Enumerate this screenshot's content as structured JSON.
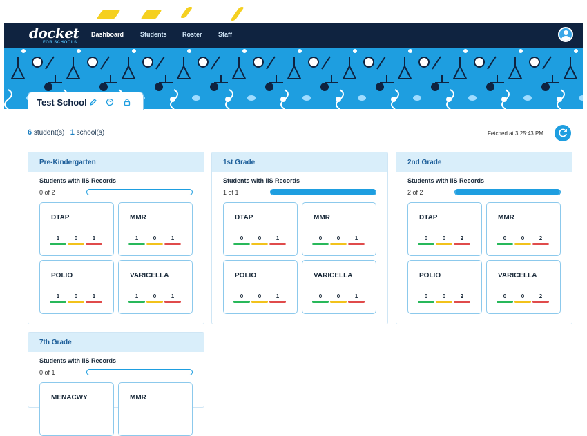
{
  "nav": {
    "logo_text": "docket",
    "logo_sub": "FOR SCHOOLS",
    "items": [
      {
        "label": "Dashboard"
      },
      {
        "label": "Students"
      },
      {
        "label": "Roster"
      },
      {
        "label": "Staff"
      }
    ]
  },
  "school": {
    "name": "Test School"
  },
  "summary": {
    "student_count": "6",
    "student_label": "student(s)",
    "school_count": "1",
    "school_label": "school(s)",
    "fetched": "Fetched at 3:25:43 PM"
  },
  "colors": {
    "navy": "#0f2340",
    "accent": "#1e9ee0",
    "green": "#28b85a",
    "yellow": "#f2c21b",
    "red": "#e04b4b"
  },
  "icons": [
    "user-avatar-icon",
    "pencil-icon",
    "palette-icon",
    "lock-icon",
    "refresh-icon"
  ],
  "grades": [
    {
      "title": "Pre-Kindergarten",
      "iis_label": "Students with IIS Records",
      "iis_count": "0 of 2",
      "iis_fraction": 0,
      "vaccines": [
        {
          "name": "DTAP",
          "green": "1",
          "yellow": "0",
          "red": "1"
        },
        {
          "name": "MMR",
          "green": "1",
          "yellow": "0",
          "red": "1"
        },
        {
          "name": "POLIO",
          "green": "1",
          "yellow": "0",
          "red": "1"
        },
        {
          "name": "VARICELLA",
          "green": "1",
          "yellow": "0",
          "red": "1"
        }
      ]
    },
    {
      "title": "1st Grade",
      "iis_label": "Students with IIS Records",
      "iis_count": "1 of 1",
      "iis_fraction": 1,
      "vaccines": [
        {
          "name": "DTAP",
          "green": "0",
          "yellow": "0",
          "red": "1"
        },
        {
          "name": "MMR",
          "green": "0",
          "yellow": "0",
          "red": "1"
        },
        {
          "name": "POLIO",
          "green": "0",
          "yellow": "0",
          "red": "1"
        },
        {
          "name": "VARICELLA",
          "green": "0",
          "yellow": "0",
          "red": "1"
        }
      ]
    },
    {
      "title": "2nd Grade",
      "iis_label": "Students with IIS Records",
      "iis_count": "2 of 2",
      "iis_fraction": 1,
      "vaccines": [
        {
          "name": "DTAP",
          "green": "0",
          "yellow": "0",
          "red": "2"
        },
        {
          "name": "MMR",
          "green": "0",
          "yellow": "0",
          "red": "2"
        },
        {
          "name": "POLIO",
          "green": "0",
          "yellow": "0",
          "red": "2"
        },
        {
          "name": "VARICELLA",
          "green": "0",
          "yellow": "0",
          "red": "2"
        }
      ]
    },
    {
      "title": "7th Grade",
      "iis_label": "Students with IIS Records",
      "iis_count": "0 of 1",
      "iis_fraction": 0,
      "vaccines": [
        {
          "name": "MENACWY"
        },
        {
          "name": "MMR"
        }
      ]
    }
  ]
}
